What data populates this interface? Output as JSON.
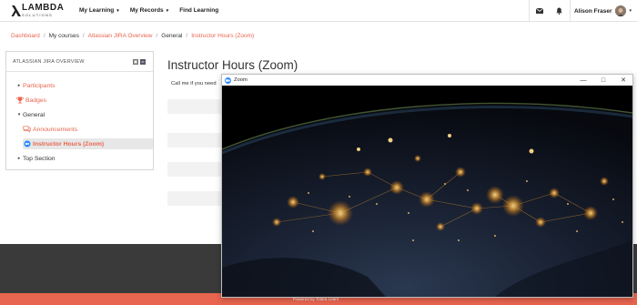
{
  "navbar": {
    "logo_main": "LAMBDA",
    "logo_sub": "SOLUTIONS",
    "menu": [
      {
        "label": "My Learning",
        "has_caret": true
      },
      {
        "label": "My Records",
        "has_caret": true
      },
      {
        "label": "Find Learning",
        "has_caret": false
      }
    ],
    "icons": [
      "envelope-icon",
      "bell-icon"
    ],
    "user_name": "Alison Fraser",
    "caret": "▾"
  },
  "breadcrumb": [
    {
      "label": "Dashboard",
      "link": true
    },
    {
      "label": "My courses",
      "link": false
    },
    {
      "label": "Atlassian JIRA Overview",
      "link": true
    },
    {
      "label": "General",
      "link": false
    },
    {
      "label": "Instructor Hours (Zoom)",
      "link": true
    }
  ],
  "breadcrumb_sep": "/",
  "block": {
    "title": "ATLASSIAN JIRA OVERVIEW",
    "items": [
      {
        "label": "Participants",
        "arrow": "▸",
        "link": true
      },
      {
        "label": "Badges",
        "arrow": "",
        "link": true,
        "icon": "trophy-icon"
      },
      {
        "label": "General",
        "arrow": "▾",
        "link": false
      },
      {
        "label": "Announcements",
        "arrow": "",
        "link": true,
        "icon": "forum-icon"
      },
      {
        "label": "Instructor Hours (Zoom)",
        "arrow": "",
        "link": true,
        "icon": "zoom-icon",
        "active": true
      },
      {
        "label": "Top Section",
        "arrow": "▸",
        "link": false
      }
    ]
  },
  "main": {
    "title": "Instructor Hours (Zoom)",
    "call_text": "Call me if you need"
  },
  "footer": {
    "powered_by": "Powered by Totara Learn"
  },
  "zoom_window": {
    "title": "Zoom",
    "controls": {
      "minimize": "—",
      "maximize": "□",
      "close": "✕"
    }
  },
  "colors": {
    "accent": "#e8654f",
    "zoom_blue": "#2d8cff",
    "footer_dark": "#3a3a3a"
  }
}
